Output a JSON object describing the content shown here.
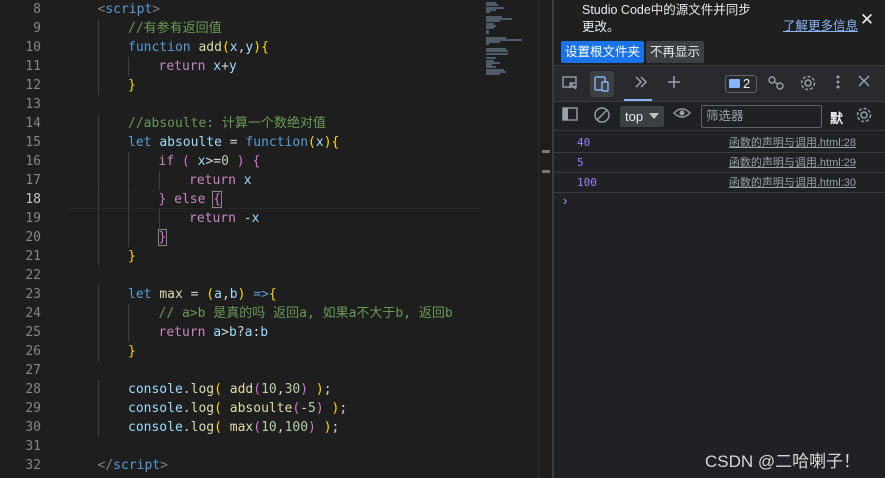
{
  "editor": {
    "active_line": "18",
    "lines": [
      {
        "num": "8"
      },
      {
        "num": "9"
      },
      {
        "num": "10"
      },
      {
        "num": "11"
      },
      {
        "num": "12"
      },
      {
        "num": "13"
      },
      {
        "num": "14"
      },
      {
        "num": "15"
      },
      {
        "num": "16"
      },
      {
        "num": "17"
      },
      {
        "num": "18"
      },
      {
        "num": "19"
      },
      {
        "num": "20"
      },
      {
        "num": "21"
      },
      {
        "num": "22"
      },
      {
        "num": "23"
      },
      {
        "num": "24"
      },
      {
        "num": "25"
      },
      {
        "num": "26"
      },
      {
        "num": "27"
      },
      {
        "num": "28"
      },
      {
        "num": "29"
      },
      {
        "num": "30"
      },
      {
        "num": "31"
      },
      {
        "num": "32"
      }
    ],
    "code": [
      [
        [
          "t",
          "<"
        ],
        [
          "tn",
          "script"
        ],
        [
          "t",
          ">"
        ]
      ],
      [
        [
          "c",
          "//有参有返回值"
        ]
      ],
      [
        [
          "k",
          "function"
        ],
        [
          "d",
          " "
        ],
        [
          "f",
          "add"
        ],
        [
          "p1",
          "("
        ],
        [
          "v",
          "x"
        ],
        [
          "d",
          ","
        ],
        [
          "v",
          "y"
        ],
        [
          "p1",
          ")"
        ],
        [
          "p1",
          "{"
        ]
      ],
      [
        [
          "ctl",
          "return"
        ],
        [
          "d",
          " "
        ],
        [
          "v",
          "x"
        ],
        [
          "d",
          "+"
        ],
        [
          "v",
          "y"
        ]
      ],
      [
        [
          "p1",
          "}"
        ]
      ],
      [],
      [
        [
          "c",
          "//absoulte: 计算一个数绝对值"
        ]
      ],
      [
        [
          "k",
          "let"
        ],
        [
          "d",
          " "
        ],
        [
          "v",
          "absoulte"
        ],
        [
          "d",
          " = "
        ],
        [
          "k",
          "function"
        ],
        [
          "p1",
          "("
        ],
        [
          "v",
          "x"
        ],
        [
          "p1",
          ")"
        ],
        [
          "p1",
          "{"
        ]
      ],
      [
        [
          "ctl",
          "if"
        ],
        [
          "d",
          " "
        ],
        [
          "p2",
          "("
        ],
        [
          "d",
          " "
        ],
        [
          "v",
          "x"
        ],
        [
          "d",
          ">="
        ],
        [
          "n",
          "0"
        ],
        [
          "d",
          " "
        ],
        [
          "p2",
          ")"
        ],
        [
          "d",
          " "
        ],
        [
          "p2",
          "{"
        ]
      ],
      [
        [
          "ctl",
          "return"
        ],
        [
          "d",
          " "
        ],
        [
          "v",
          "x"
        ]
      ],
      [
        [
          "p2",
          "}"
        ],
        [
          "d",
          " "
        ],
        [
          "ctl",
          "else"
        ],
        [
          "d",
          " "
        ],
        [
          "p2b",
          "{"
        ]
      ],
      [
        [
          "ctl",
          "return"
        ],
        [
          "d",
          " -"
        ],
        [
          "v",
          "x"
        ]
      ],
      [
        [
          "p2b",
          "}"
        ]
      ],
      [
        [
          "p1",
          "}"
        ]
      ],
      [],
      [
        [
          "k",
          "let"
        ],
        [
          "d",
          " "
        ],
        [
          "f",
          "max"
        ],
        [
          "d",
          " = "
        ],
        [
          "p1",
          "("
        ],
        [
          "v",
          "a"
        ],
        [
          "d",
          ","
        ],
        [
          "v",
          "b"
        ],
        [
          "p1",
          ")"
        ],
        [
          "d",
          " "
        ],
        [
          "k",
          "=>"
        ],
        [
          "p1",
          "{"
        ]
      ],
      [
        [
          "c",
          "// a>b 是真的吗 返回a, 如果a不大于b, 返回b"
        ]
      ],
      [
        [
          "ctl",
          "return"
        ],
        [
          "d",
          " "
        ],
        [
          "v",
          "a"
        ],
        [
          "d",
          ">"
        ],
        [
          "v",
          "b"
        ],
        [
          "d",
          "?"
        ],
        [
          "v",
          "a"
        ],
        [
          "d",
          ":"
        ],
        [
          "v",
          "b"
        ]
      ],
      [
        [
          "p1",
          "}"
        ]
      ],
      [],
      [
        [
          "v",
          "console"
        ],
        [
          "d",
          "."
        ],
        [
          "f",
          "log"
        ],
        [
          "p1",
          "("
        ],
        [
          "d",
          " "
        ],
        [
          "f",
          "add"
        ],
        [
          "p2",
          "("
        ],
        [
          "n",
          "10"
        ],
        [
          "d",
          ","
        ],
        [
          "n",
          "30"
        ],
        [
          "p2",
          ")"
        ],
        [
          "d",
          " "
        ],
        [
          "p1",
          ")"
        ],
        [
          "d",
          ";"
        ]
      ],
      [
        [
          "v",
          "console"
        ],
        [
          "d",
          "."
        ],
        [
          "f",
          "log"
        ],
        [
          "p1",
          "("
        ],
        [
          "d",
          " "
        ],
        [
          "f",
          "absoulte"
        ],
        [
          "p2",
          "("
        ],
        [
          "d",
          "-"
        ],
        [
          "n",
          "5"
        ],
        [
          "p2",
          ")"
        ],
        [
          "d",
          " "
        ],
        [
          "p1",
          ")"
        ],
        [
          "d",
          ";"
        ]
      ],
      [
        [
          "v",
          "console"
        ],
        [
          "d",
          "."
        ],
        [
          "f",
          "log"
        ],
        [
          "p1",
          "("
        ],
        [
          "d",
          " "
        ],
        [
          "f",
          "max"
        ],
        [
          "p2",
          "("
        ],
        [
          "n",
          "10"
        ],
        [
          "d",
          ","
        ],
        [
          "n",
          "100"
        ],
        [
          "p2",
          ")"
        ],
        [
          "d",
          " "
        ],
        [
          "p1",
          ")"
        ],
        [
          "d",
          ";"
        ]
      ],
      [],
      [
        [
          "t",
          "</"
        ],
        [
          "tn",
          "script"
        ],
        [
          "t",
          ">"
        ]
      ]
    ],
    "indent_levels": [
      1,
      2,
      2,
      3,
      2,
      0,
      2,
      2,
      3,
      4,
      3,
      4,
      3,
      2,
      0,
      2,
      3,
      3,
      2,
      0,
      2,
      2,
      2,
      0,
      1
    ]
  },
  "devtools": {
    "notice": {
      "text": "Studio Code中的源文件并同步更改。",
      "learn_more": "了解更多信息",
      "close_icon": "✕",
      "set_root_button": "设置根文件夹",
      "never_show_button": "不再显示"
    },
    "tabs": {
      "issues_count": "2",
      "icons": [
        "inspect-icon",
        "device-toolbar-icon",
        "more-tabs-icon",
        "add-tab-icon",
        "messages-icon",
        "network-icon",
        "settings-icon",
        "more-options-icon",
        "close-icon"
      ]
    },
    "console_toolbar": {
      "context": "top",
      "filter_placeholder": "筛选器",
      "levels_label": "默"
    },
    "messages": [
      {
        "value": "40",
        "source": "函数的声明与调用.html:28"
      },
      {
        "value": "5",
        "source": "函数的声明与调用.html:29"
      },
      {
        "value": "100",
        "source": "函数的声明与调用.html:30"
      }
    ],
    "prompt": "›"
  },
  "watermark": "CSDN @二哈喇子！"
}
